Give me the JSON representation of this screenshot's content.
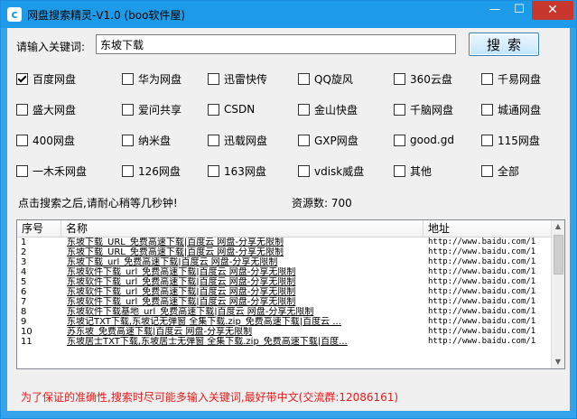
{
  "window": {
    "title": "网盘搜索精灵-V1.0  (boo软件屋)",
    "app_icon": "c",
    "minimize": "—",
    "maximize": "☐",
    "close": "✕"
  },
  "search": {
    "label": "请输入关键词:",
    "value": "东坡下载",
    "button": "搜索"
  },
  "sources": [
    {
      "label": "百度网盘",
      "checked": true
    },
    {
      "label": "华为网盘",
      "checked": false
    },
    {
      "label": "迅雷快传",
      "checked": false
    },
    {
      "label": "QQ旋风",
      "checked": false
    },
    {
      "label": "360云盘",
      "checked": false
    },
    {
      "label": "千易网盘",
      "checked": false
    },
    {
      "label": "盛大网盘",
      "checked": false
    },
    {
      "label": "爱问共享",
      "checked": false
    },
    {
      "label": "CSDN",
      "checked": false
    },
    {
      "label": "金山快盘",
      "checked": false
    },
    {
      "label": "千脑网盘",
      "checked": false
    },
    {
      "label": "城通网盘",
      "checked": false
    },
    {
      "label": "400网盘",
      "checked": false
    },
    {
      "label": "纳米盘",
      "checked": false
    },
    {
      "label": "迅载网盘",
      "checked": false
    },
    {
      "label": "GXP网盘",
      "checked": false
    },
    {
      "label": "good.gd",
      "checked": false
    },
    {
      "label": "115网盘",
      "checked": false
    },
    {
      "label": "一木禾网盘",
      "checked": false
    },
    {
      "label": "126网盘",
      "checked": false
    },
    {
      "label": "163网盘",
      "checked": false
    },
    {
      "label": "vdisk威盘",
      "checked": false
    },
    {
      "label": "其他",
      "checked": false
    },
    {
      "label": "全部",
      "checked": false
    }
  ],
  "status": {
    "hint": "点击搜索之后,请耐心稍等几秒钟!",
    "count_label": "资源数:",
    "count_value": "700"
  },
  "results": {
    "columns": [
      "序号",
      "名称",
      "地址"
    ],
    "rows": [
      {
        "no": "1",
        "name": "东坡下载_URL_免费高速下载|百度云 网盘-分享无限制",
        "url": "http://www.baidu.com/1"
      },
      {
        "no": "2",
        "name": "东坡下载_URL_免费高速下载|百度云 网盘-分享无限制",
        "url": "http://www.baidu.com/1"
      },
      {
        "no": "3",
        "name": "东坡下载_url_免费高速下载|百度云 网盘-分享无限制",
        "url": "http://www.baidu.com/1"
      },
      {
        "no": "4",
        "name": "东坡软件下载_url_免费高速下载|百度云 网盘-分享无限制",
        "url": "http://www.baidu.com/1"
      },
      {
        "no": "5",
        "name": "东坡软件下载_url_免费高速下载|百度云 网盘-分享无限制",
        "url": "http://www.baidu.com/1"
      },
      {
        "no": "6",
        "name": "东坡软件下载_url_免费高速下载|百度云 网盘-分享无限制",
        "url": "http://www.baidu.com/1"
      },
      {
        "no": "7",
        "name": "东坡软件下载_url_免费高速下载|百度云 网盘-分享无限制",
        "url": "http://www.baidu.com/1"
      },
      {
        "no": "8",
        "name": "东坡软件下载基地_url_免费高速下载|百度云 网盘-分享无限制",
        "url": "http://www.baidu.com/1"
      },
      {
        "no": "9",
        "name": "东坡记TXT下载,东坡记无弹窗 全集下载.zip_免费高速下载|百度云 ...",
        "url": "http://www.baidu.com/1"
      },
      {
        "no": "10",
        "name": "苏东坡_免费高速下载|百度云 网盘-分享无限制",
        "url": "http://www.baidu.com/1"
      },
      {
        "no": "11",
        "name": "东坡居士TXT下载,东坡居士无弹窗 全集下载.zip_免费高速下载|百度...",
        "url": "http://www.baidu.com/1"
      }
    ]
  },
  "footer": {
    "note": "为了保证的准确性,搜索时尽可能多输入关键词,最好带中文(交流群:12086161)"
  },
  "colors": {
    "titlebar": "#1e9be8",
    "close": "#c8372d",
    "footer_note": "#e51c1c"
  }
}
